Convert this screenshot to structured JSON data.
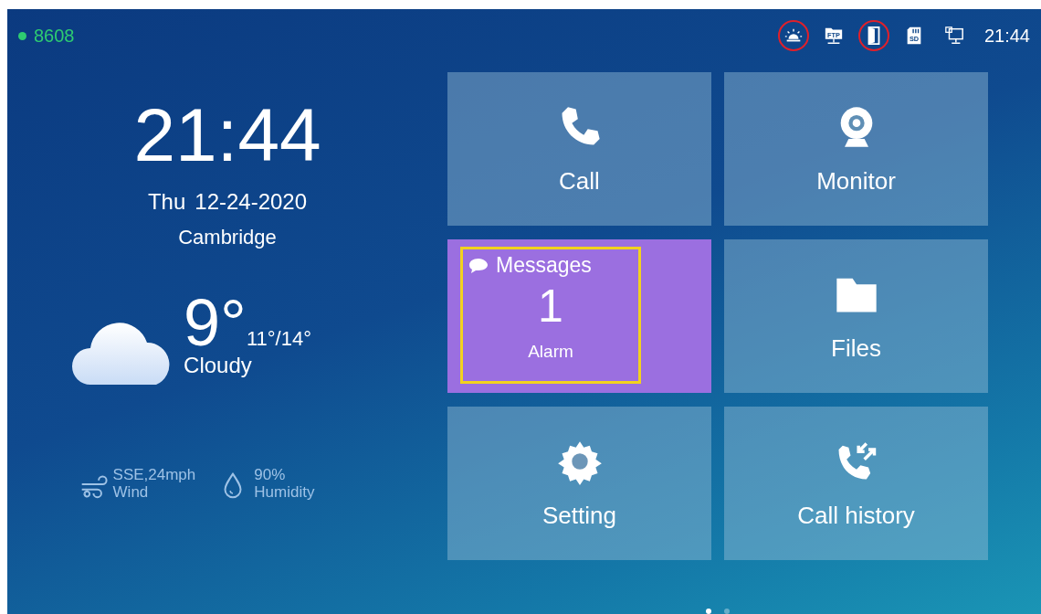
{
  "status_bar": {
    "account": {
      "extension": "8608",
      "color": "#2ecc71"
    },
    "icons": [
      {
        "kind": "alarm",
        "highlighted": true
      },
      {
        "kind": "ftp",
        "label": "FTP",
        "highlighted": false
      },
      {
        "kind": "door",
        "highlighted": true
      },
      {
        "kind": "sd",
        "label": "SD",
        "highlighted": false
      },
      {
        "kind": "network",
        "highlighted": false
      }
    ],
    "time": "21:44"
  },
  "clock": {
    "time": "21:44",
    "day": "Thu",
    "date": "12-24-2020",
    "city": "Cambridge"
  },
  "weather": {
    "temperature": "9°",
    "range": "11°/14°",
    "condition": "Cloudy",
    "details": [
      {
        "kind": "wind",
        "value": "SSE,24mph",
        "label": "Wind"
      },
      {
        "kind": "humidity",
        "value": "90%",
        "label": "Humidity"
      }
    ]
  },
  "tiles": [
    {
      "kind": "call",
      "label": "Call"
    },
    {
      "kind": "monitor",
      "label": "Monitor"
    },
    {
      "kind": "messages",
      "title": "Messages",
      "count": "1",
      "subtitle": "Alarm",
      "highlighted": true
    },
    {
      "kind": "files",
      "label": "Files"
    },
    {
      "kind": "setting",
      "label": "Setting"
    },
    {
      "kind": "call_history",
      "label": "Call history"
    }
  ],
  "pages": [
    {
      "selected": true
    },
    {
      "selected": false
    }
  ]
}
